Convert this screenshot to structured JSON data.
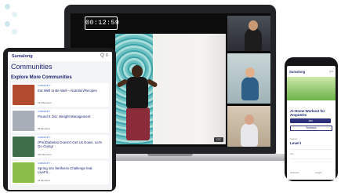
{
  "laptop": {
    "timer": "00:12:59",
    "cc_label": "CC"
  },
  "tablet": {
    "brand": "Sumalong",
    "header_icons": "Q  ≡",
    "title": "Communities",
    "section_title": "Explore More Communities",
    "cards": [
      {
        "kicker": "COMMUNITY",
        "name": "Eat Well to Be Well – Nutrition/Recipes",
        "members": "134 Members",
        "thumb_color": "#b24a2e"
      },
      {
        "kicker": "COMMUNITY",
        "name": "Pound It Out: Weight Management",
        "members": "86 Members",
        "thumb_color": "#a8aeb8"
      },
      {
        "kicker": "COMMUNITY",
        "name": "(Pre)Diabetes Doesn't Get Us Down, Let's Go Going!",
        "members": "226 Members",
        "thumb_color": "#3f6f4a"
      },
      {
        "kicker": "COMMUNITY",
        "name": "Spring into Wellness Challenge feat. LiveFit...",
        "members": "28 Members",
        "thumb_color": "#8bbd4a"
      }
    ]
  },
  "phone": {
    "brand": "Sumalong",
    "header_icons": "Q ≡",
    "title": "At-Home Workout for Amputees",
    "primary_button": "Join",
    "secondary_button": "Schedule",
    "level_label": "Course",
    "level": "Level I",
    "row_label": "Info",
    "columns": [
      "Instructor",
      "Length"
    ]
  },
  "colors": {
    "brand": "#2c2f7c",
    "accent": "#3a6bd0"
  }
}
